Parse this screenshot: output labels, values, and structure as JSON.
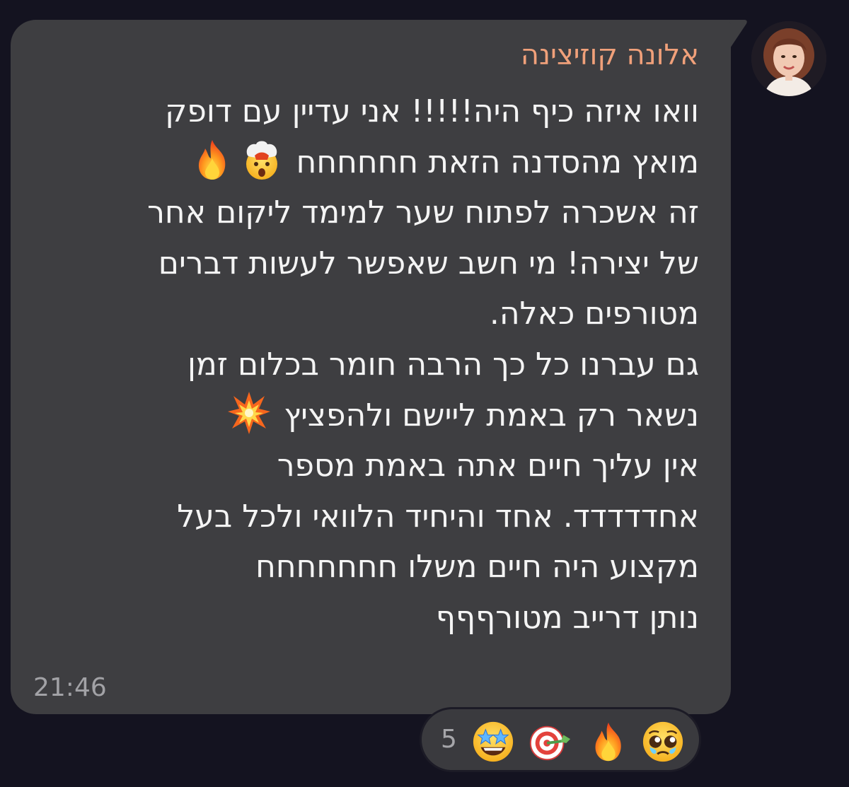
{
  "chat": {
    "sender_name": "אלונה קוזיצינה",
    "message_lines": [
      "וואו איזה כיף היה!!!!! אני עדיין עם דופק",
      "מואץ מהסדנה הזאת חחחחחח",
      "זה אשכרה לפתוח שער למימד ליקום אחר",
      "של יצירה! מי חשב שאפשר לעשות דברים",
      "מטורפים כאלה.",
      "גם עברנו כל כך הרבה חומר בכלום זמן",
      "נשאר רק באמת ליישם ולהפציץ",
      "אין עליך חיים אתה באמת מספר",
      "אחדדדדד. אחד והיחיד הלוואי ולכל בעל",
      "מקצוע היה חיים משלו חחחחחחח",
      "נותן דרייב מטורףףף"
    ],
    "inline_emojis": {
      "line2": [
        "exploding-head-emoji",
        "fire-emoji"
      ],
      "line7": [
        "collision-emoji"
      ]
    },
    "time": "21:46",
    "reactions": {
      "count": "5",
      "emojis": [
        "star-struck-emoji",
        "direct-hit-emoji",
        "fire-emoji",
        "pleading-face-emoji"
      ]
    }
  },
  "colors": {
    "background": "#141320",
    "bubble": "#3e3e41",
    "sender_name": "#f0a07a",
    "message_text": "#f4f4f4",
    "time": "#a2a2a6"
  }
}
